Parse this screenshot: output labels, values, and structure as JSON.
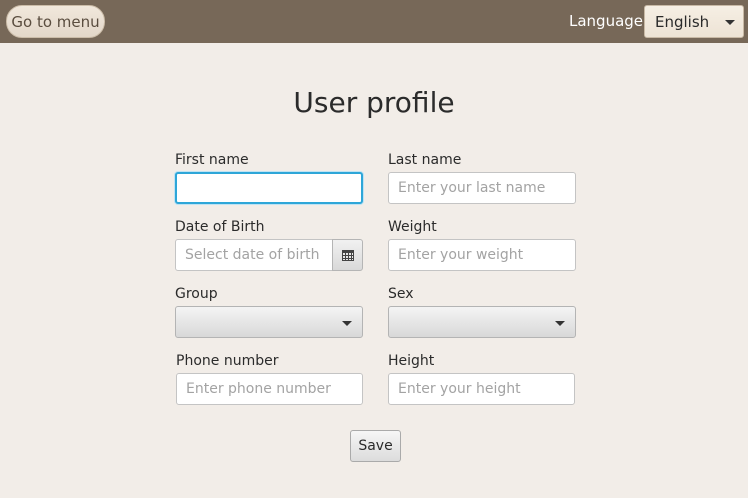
{
  "topbar": {
    "menu_button": "Go to menu",
    "language_label": "Language:",
    "language_value": "English"
  },
  "form": {
    "title": "User profile",
    "first_name": {
      "label": "First name",
      "value": "",
      "placeholder": ""
    },
    "last_name": {
      "label": "Last name",
      "value": "",
      "placeholder": "Enter your last name"
    },
    "date_of_birth": {
      "label": "Date of Birth",
      "value": "",
      "placeholder": "Select date of birth"
    },
    "weight": {
      "label": "Weight",
      "value": "",
      "placeholder": "Enter your weight"
    },
    "group": {
      "label": "Group",
      "value": ""
    },
    "sex": {
      "label": "Sex",
      "value": ""
    },
    "phone": {
      "label": "Phone number",
      "value": "",
      "placeholder": "Enter phone number"
    },
    "height": {
      "label": "Height",
      "value": "",
      "placeholder": "Enter your height"
    },
    "save_button": "Save"
  },
  "icons": {
    "calendar": "calendar-icon",
    "dropdown": "chevron-down-icon"
  },
  "colors": {
    "topbar": "#776858",
    "background": "#f2ede8",
    "focus": "#2ea6d8"
  }
}
